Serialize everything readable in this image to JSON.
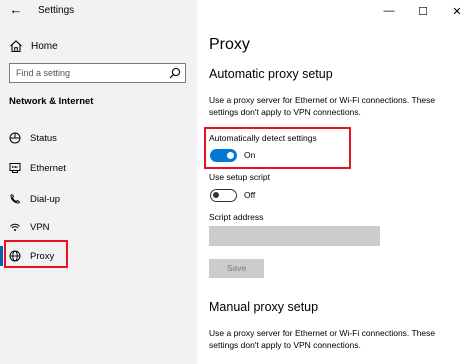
{
  "window": {
    "app_title": "Settings",
    "minimize": "—",
    "maximize": "☐",
    "close": "✕"
  },
  "sidebar": {
    "home_label": "Home",
    "search_placeholder": "Find a setting",
    "section_title": "Network & Internet",
    "items": [
      {
        "label": "Status",
        "icon": "status-icon"
      },
      {
        "label": "Ethernet",
        "icon": "ethernet-icon"
      },
      {
        "label": "Dial-up",
        "icon": "dialup-icon"
      },
      {
        "label": "VPN",
        "icon": "vpn-icon"
      },
      {
        "label": "Proxy",
        "icon": "globe-icon",
        "selected": true
      }
    ]
  },
  "main": {
    "page_title": "Proxy",
    "auto_section": {
      "heading": "Automatic proxy setup",
      "description": "Use a proxy server for Ethernet or Wi-Fi connections. These settings don't apply to VPN connections.",
      "detect_label": "Automatically detect settings",
      "detect_state": "On",
      "script_label": "Use setup script",
      "script_state": "Off",
      "address_label": "Script address",
      "address_value": "",
      "save_label": "Save"
    },
    "manual_section": {
      "heading": "Manual proxy setup",
      "description": "Use a proxy server for Ethernet or Wi-Fi connections. These settings don't apply to VPN connections."
    }
  },
  "colors": {
    "accent": "#0078d7",
    "highlight": "#e81123",
    "sidebar_bg": "#f2f2f2"
  }
}
